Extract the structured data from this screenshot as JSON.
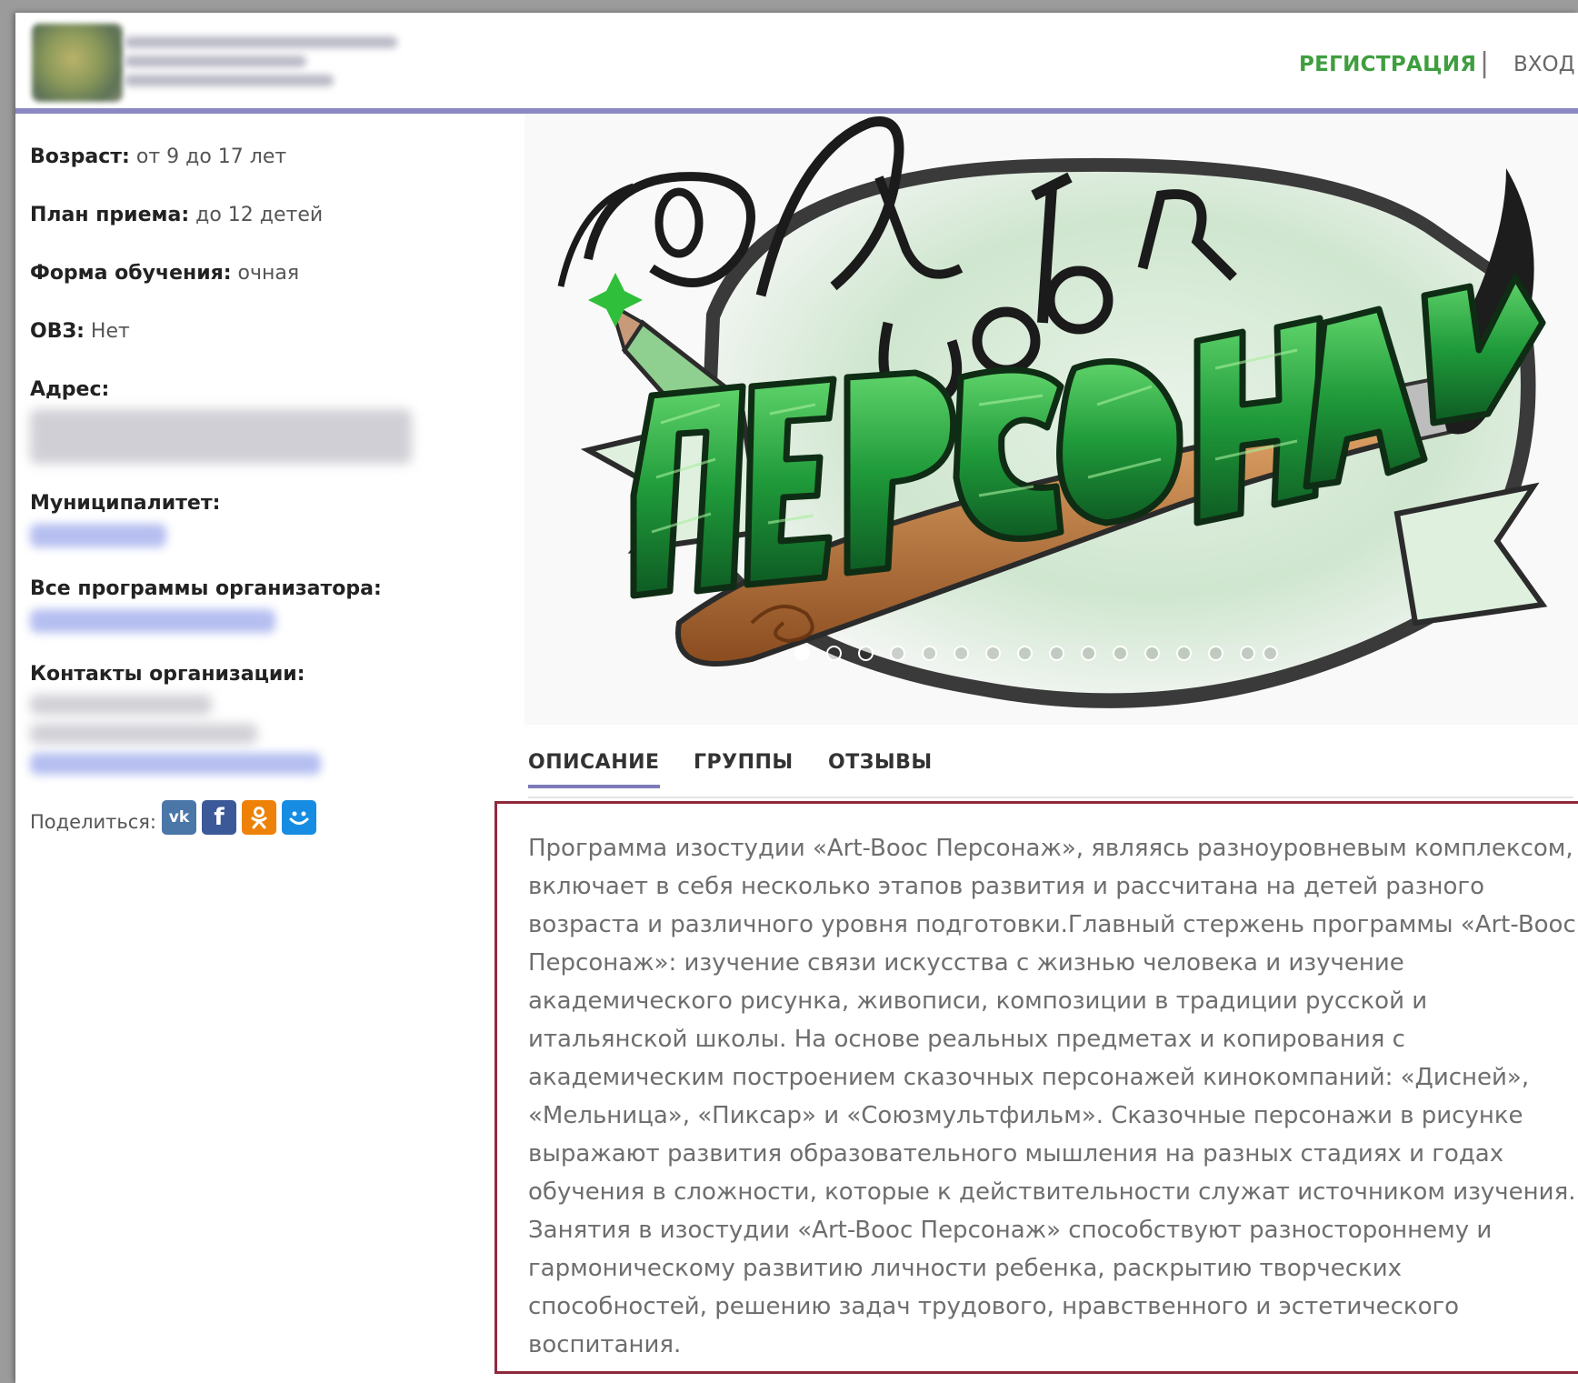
{
  "header": {
    "org_name": "",
    "register_label": "РЕГИСТРАЦИЯ",
    "separator": "|",
    "login_label": "ВХОД"
  },
  "info": {
    "age_label": "Возраст:",
    "age_value": "от 9 до 17 лет",
    "plan_label": "План приема:",
    "plan_value": "до 12 детей",
    "form_label": "Форма обучения:",
    "form_value": "очная",
    "ovz_label": "ОВЗ:",
    "ovz_value": "Нет",
    "address_label": "Адрес:",
    "municipality_label": "Муниципалитет:",
    "programs_label": "Все программы организатора:",
    "contacts_label": "Контакты организации:"
  },
  "share": {
    "label": "Поделиться:",
    "buttons": [
      "vk",
      "facebook",
      "odnoklassniki",
      "moimir"
    ]
  },
  "banner": {
    "slide_count": 16,
    "active_slide": 0
  },
  "tabs": [
    "ОПИСАНИЕ",
    "ГРУППЫ",
    "ОТЗЫВЫ"
  ],
  "active_tab": 0,
  "description": "Программа изостудии «Art-Boос Персонаж», являясь разноуровневым комплексом, включает в себя несколько этапов развития и рассчитана на детей разного возраста и различного уровня подготовки.Главный стержень программы «Art-Boос Персонаж»: изучение связи искусства с жизнью человека и изучение академического рисунка, живописи, композиции в традиции русской и итальянской школы. На основе реальных предметах и копирования с академическим построением сказочных персонажей кинокомпаний: «Дисней», «Мельница», «Пиксар» и «Союзмультфильм». Сказочные персонажи в рисунке выражают развития образовательного мышления на разных стадиях и годах обучения в сложности, которые к действительности служат источником изучения. Занятия в изостудии «Art-Boос Персонаж» способствуют разностороннему и гармоническому развитию личности ребенка, раскрытию творческих способностей, решению задач трудового, нравственного и эстетического воспитания.",
  "colors": {
    "register": "#3f9e3f",
    "header_line": "#8b88c4",
    "desc_border": "#8e2a3c",
    "vk": "#4a76a8",
    "facebook": "#3b5998",
    "odnoklassniki": "#ee8208",
    "moimir": "#168de2"
  }
}
